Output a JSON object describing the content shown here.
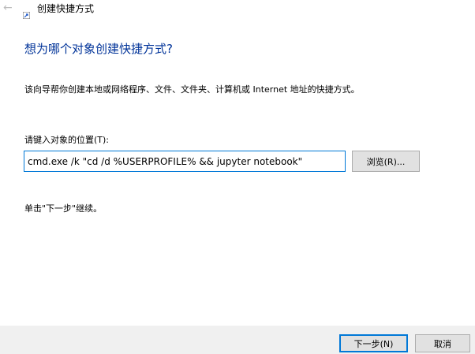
{
  "window": {
    "title": "创建快捷方式",
    "back_icon": "back-arrow-icon",
    "app_icon": "shortcut-icon"
  },
  "wizard": {
    "heading": "想为哪个对象创建快捷方式?",
    "description": "该向导帮你创建本地或网络程序、文件、文件夹、计算机或 Internet 地址的快捷方式。",
    "location_label": "请键入对象的位置(T):",
    "location_value": "cmd.exe /k \"cd /d %USERPROFILE% && jupyter notebook\"",
    "browse_label": "浏览(R)...",
    "instruction": "单击\"下一步\"继续。"
  },
  "footer": {
    "next_label": "下一步(N)",
    "cancel_label": "取消"
  },
  "colors": {
    "heading": "#003399",
    "focus_border": "#0078d7",
    "footer_bg": "#f0f0f0",
    "button_bg": "#e1e1e1"
  }
}
